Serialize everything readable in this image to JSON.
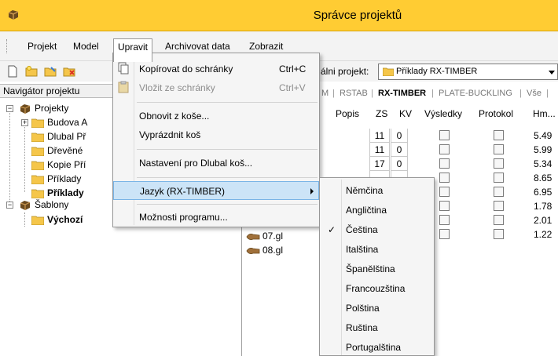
{
  "window": {
    "title": "Správce projektů",
    "accent": "#ffcc33"
  },
  "menubar": {
    "items": [
      {
        "label": "Projekt"
      },
      {
        "label": "Model"
      },
      {
        "label": "Upravit"
      },
      {
        "label": "Archivovat data"
      },
      {
        "label": "Zobrazit"
      }
    ]
  },
  "toolbar": {
    "current_project_label": "álni projekt:",
    "current_project_value": "Příklady RX-TIMBER"
  },
  "navigator": {
    "header": "Navigátor projektu",
    "tree": [
      {
        "label": "Projekty",
        "bold": false
      },
      {
        "label": "Budova A",
        "bold": false
      },
      {
        "label": "Dlubal Př",
        "bold": false
      },
      {
        "label": "Dřevěné",
        "bold": false
      },
      {
        "label": "Kopie Pří",
        "bold": false
      },
      {
        "label": "Příklady",
        "bold": false
      },
      {
        "label": "Příklady",
        "bold": true
      },
      {
        "label": "Šablony",
        "bold": false
      },
      {
        "label": "Výchozí",
        "bold": true
      }
    ]
  },
  "tabs": [
    {
      "label": "M"
    },
    {
      "label": "RSTAB"
    },
    {
      "label": "RX-TIMBER",
      "active": true
    },
    {
      "label": "PLATE-BUCKLING"
    },
    {
      "label": "Vše"
    }
  ],
  "table": {
    "columns": [
      "Popis",
      "ZS",
      "KV",
      "Výsledky",
      "Protokol",
      "Hm..."
    ],
    "rows": [
      {
        "zs": "11",
        "kv": "0",
        "hm": "5.49"
      },
      {
        "zs": "11",
        "kv": "0",
        "hm": "5.99"
      },
      {
        "zs": "17",
        "kv": "0",
        "hm": "5.34"
      },
      {
        "zs": "",
        "kv": "",
        "hm": "8.65"
      },
      {
        "zs": "",
        "kv": "",
        "hm": "6.95"
      },
      {
        "zs": "",
        "kv": "",
        "hm": "1.78"
      },
      {
        "zs": "",
        "kv": "",
        "hm": "2.01"
      },
      {
        "zs": "",
        "kv": "",
        "hm": "1.22"
      }
    ],
    "files": [
      "07.gl",
      "08.gl"
    ]
  },
  "edit_menu": {
    "items": [
      {
        "label": "Kopírovat do schránky",
        "shortcut": "Ctrl+C"
      },
      {
        "label": "Vložit ze schránky",
        "shortcut": "Ctrl+V"
      },
      {
        "label": "Obnovit z koše..."
      },
      {
        "label": "Vyprázdnit koš"
      },
      {
        "label": "Nastavení pro Dlubal koš..."
      },
      {
        "label": "Jazyk (RX-TIMBER)"
      },
      {
        "label": "Možnosti programu..."
      }
    ]
  },
  "language_submenu": {
    "items": [
      {
        "label": "Němčina"
      },
      {
        "label": "Angličtina"
      },
      {
        "label": "Čeština",
        "checked": true
      },
      {
        "label": "Italština"
      },
      {
        "label": "Španělština"
      },
      {
        "label": "Francouzština"
      },
      {
        "label": "Polština"
      },
      {
        "label": "Ruština"
      },
      {
        "label": "Portugalština"
      }
    ],
    "check_glyph": "✓"
  }
}
